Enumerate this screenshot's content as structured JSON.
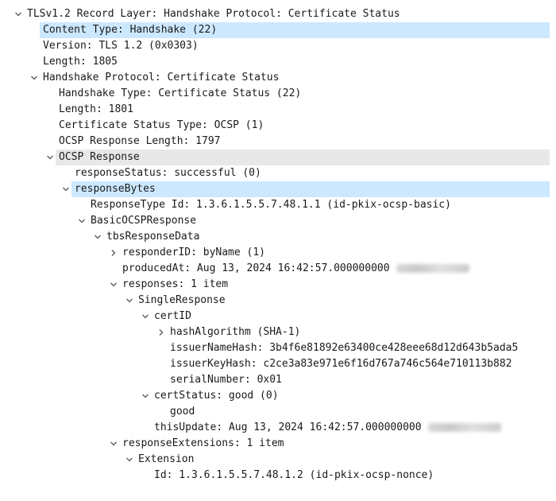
{
  "tree": [
    {
      "label": "TLSv1.2 Record Layer: Handshake Protocol: Certificate Status",
      "level": 0,
      "state": "expanded",
      "name": "tls-record-layer"
    },
    {
      "label": "Content Type: Handshake (22)",
      "level": 1,
      "state": "leaf",
      "highlight": "blue",
      "name": "content-type"
    },
    {
      "label": "Version: TLS 1.2 (0x0303)",
      "level": 1,
      "state": "leaf",
      "name": "version"
    },
    {
      "label": "Length: 1805",
      "level": 1,
      "state": "leaf",
      "name": "record-length"
    },
    {
      "label": "Handshake Protocol: Certificate Status",
      "level": 1,
      "state": "expanded",
      "name": "handshake-protocol"
    },
    {
      "label": "Handshake Type: Certificate Status (22)",
      "level": 2,
      "state": "leaf",
      "name": "handshake-type"
    },
    {
      "label": "Length: 1801",
      "level": 2,
      "state": "leaf",
      "name": "handshake-length"
    },
    {
      "label": "Certificate Status Type: OCSP (1)",
      "level": 2,
      "state": "leaf",
      "name": "certificate-status-type"
    },
    {
      "label": "OCSP Response Length: 1797",
      "level": 2,
      "state": "leaf",
      "name": "ocsp-response-length"
    },
    {
      "label": "OCSP Response",
      "level": 2,
      "state": "expanded",
      "highlight": "gray",
      "name": "ocsp-response"
    },
    {
      "label": "responseStatus: successful (0)",
      "level": 3,
      "state": "leaf",
      "name": "response-status"
    },
    {
      "label": "responseBytes",
      "level": 3,
      "state": "expanded",
      "highlight": "blue",
      "name": "response-bytes"
    },
    {
      "label": "ResponseType Id: 1.3.6.1.5.5.7.48.1.1 (id-pkix-ocsp-basic)",
      "level": 4,
      "state": "leaf",
      "name": "response-type-id"
    },
    {
      "label": "BasicOCSPResponse",
      "level": 4,
      "state": "expanded",
      "name": "basic-ocsp-response"
    },
    {
      "label": "tbsResponseData",
      "level": 5,
      "state": "expanded",
      "name": "tbs-response-data"
    },
    {
      "label": "responderID: byName (1)",
      "level": 6,
      "state": "collapsed",
      "name": "responder-id"
    },
    {
      "label": "producedAt: Aug 13, 2024 16:42:57.000000000",
      "level": 6,
      "state": "leaf",
      "redacted": true,
      "name": "produced-at"
    },
    {
      "label": "responses: 1 item",
      "level": 6,
      "state": "expanded",
      "name": "responses"
    },
    {
      "label": "SingleResponse",
      "level": 7,
      "state": "expanded",
      "name": "single-response"
    },
    {
      "label": "certID",
      "level": 8,
      "state": "expanded",
      "name": "cert-id"
    },
    {
      "label": "hashAlgorithm (SHA-1)",
      "level": 9,
      "state": "collapsed",
      "name": "hash-algorithm"
    },
    {
      "label": "issuerNameHash: 3b4f6e81892e63400ce428eee68d12d643b5ada5",
      "level": 9,
      "state": "leaf",
      "name": "issuer-name-hash"
    },
    {
      "label": "issuerKeyHash: c2ce3a83e971e6f16d767a746c564e710113b882",
      "level": 9,
      "state": "leaf",
      "name": "issuer-key-hash"
    },
    {
      "label": "serialNumber: 0x01",
      "level": 9,
      "state": "leaf",
      "name": "serial-number"
    },
    {
      "label": "certStatus: good (0)",
      "level": 8,
      "state": "expanded",
      "name": "cert-status"
    },
    {
      "label": "good",
      "level": 9,
      "state": "leaf",
      "name": "cert-status-good"
    },
    {
      "label": "thisUpdate: Aug 13, 2024 16:42:57.000000000",
      "level": 8,
      "state": "leaf",
      "redacted": true,
      "name": "this-update"
    },
    {
      "label": "responseExtensions: 1 item",
      "level": 6,
      "state": "expanded",
      "name": "response-extensions"
    },
    {
      "label": "Extension",
      "level": 7,
      "state": "expanded",
      "name": "extension"
    },
    {
      "label": "Id: 1.3.6.1.5.5.7.48.1.2 (id-pkix-ocsp-nonce)",
      "level": 8,
      "state": "leaf",
      "name": "extension-id"
    }
  ]
}
